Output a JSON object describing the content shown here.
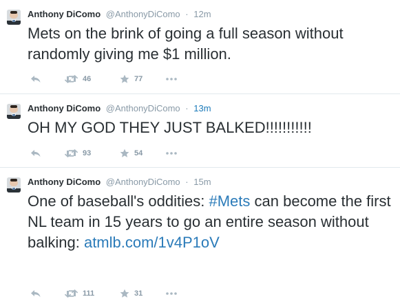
{
  "colors": {
    "text": "#292f33",
    "meta": "#8899a6",
    "link": "#2b7bb9",
    "divider": "#e1e8ed"
  },
  "tweets": [
    {
      "author": {
        "name": "Anthony DiComo",
        "handle": "@AnthonyDiComo",
        "avatar": "avatar-photo"
      },
      "separator": "·",
      "time": "12m",
      "text_parts": [
        {
          "type": "text",
          "text": "Mets on the brink of going a full season without randomly giving me $1 million."
        }
      ],
      "actions": {
        "reply_icon": "reply-icon",
        "retweet_icon": "retweet-icon",
        "retweet_count": "46",
        "favorite_icon": "star-icon",
        "favorite_count": "77",
        "more_icon": "more-icon"
      }
    },
    {
      "author": {
        "name": "Anthony DiComo",
        "handle": "@AnthonyDiComo",
        "avatar": "avatar-photo"
      },
      "separator": "·",
      "time": "13m",
      "text_parts": [
        {
          "type": "text",
          "text": "OH MY GOD THEY JUST BALKED!!!!!!!!!!!"
        }
      ],
      "actions": {
        "reply_icon": "reply-icon",
        "retweet_icon": "retweet-icon",
        "retweet_count": "93",
        "favorite_icon": "star-icon",
        "favorite_count": "54",
        "more_icon": "more-icon"
      }
    },
    {
      "author": {
        "name": "Anthony DiComo",
        "handle": "@AnthonyDiComo",
        "avatar": "avatar-photo"
      },
      "separator": "·",
      "time": "15m",
      "text_parts": [
        {
          "type": "text",
          "text": "One of baseball's oddities: "
        },
        {
          "type": "hashtag",
          "text": "#Mets"
        },
        {
          "type": "text",
          "text": " can become the first NL team in 15 years to go an entire season without balking: "
        },
        {
          "type": "link",
          "text": "atmlb.com/1v4P1oV"
        }
      ],
      "actions": {
        "reply_icon": "reply-icon",
        "retweet_icon": "retweet-icon",
        "retweet_count": "111",
        "favorite_icon": "star-icon",
        "favorite_count": "31",
        "more_icon": "more-icon"
      }
    }
  ]
}
